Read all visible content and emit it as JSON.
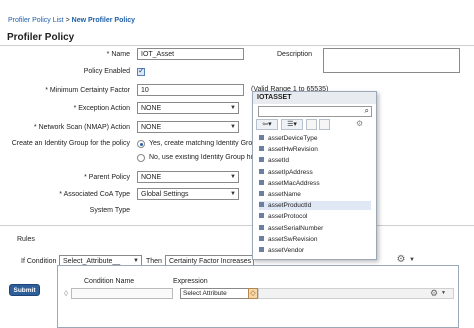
{
  "breadcrumb": {
    "parent": "Profiler Policy List",
    "separator": ">",
    "current": "New Profiler Policy"
  },
  "page_title": "Profiler Policy",
  "form": {
    "name_label": "* Name",
    "name_value": "IOT_Asset",
    "description_label": "Description",
    "description_value": "",
    "policy_enabled_label": "Policy Enabled",
    "policy_enabled": true,
    "mcf_label": "* Minimum Certainty Factor",
    "mcf_value": "10",
    "mcf_hint": "(Valid Range 1 to 65535)",
    "exception_label": "* Exception Action",
    "exception_value": "NONE",
    "nmap_label": "* Network Scan (NMAP) Action",
    "nmap_value": "NONE",
    "identity_group_label": "Create an Identity Group for the policy",
    "identity_opt_yes": "Yes, create matching Identity Grou",
    "identity_opt_no": "No, use existing Identity Group hi",
    "parent_label": "* Parent Policy",
    "parent_value": "NONE",
    "coa_label": "* Associated CoA Type",
    "coa_value": "Global Settings",
    "system_type_label": "System Type"
  },
  "rules": {
    "heading": "Rules",
    "if_label": "If Condition",
    "if_value": "Select_Attribute__",
    "then_label": "Then",
    "then_value": "Certainty Factor Increases"
  },
  "condition_table": {
    "col_name": "Condition Name",
    "col_expression": "Expression",
    "expression_value": "Select Attribute"
  },
  "submit_label": "Submit",
  "attribute_picker": {
    "title": "IOTASSET",
    "search_placeholder": "",
    "items": [
      "assetDeviceType",
      "assetHwRevision",
      "assetId",
      "assetIpAddress",
      "assetMacAddress",
      "assetName",
      "assetProductId",
      "assetProtocol",
      "assetSerialNumber",
      "assetSwRevision",
      "assetVendor"
    ],
    "highlighted_index": 6
  },
  "colors": {
    "link": "#1f5fa8",
    "submit": "#2f5f9a",
    "popup_border": "#9aa8b8"
  },
  "icons": [
    "search-icon",
    "back-arrow-icon",
    "list-view-icon",
    "gear-icon",
    "chevron-down-icon",
    "diamond-icon"
  ]
}
